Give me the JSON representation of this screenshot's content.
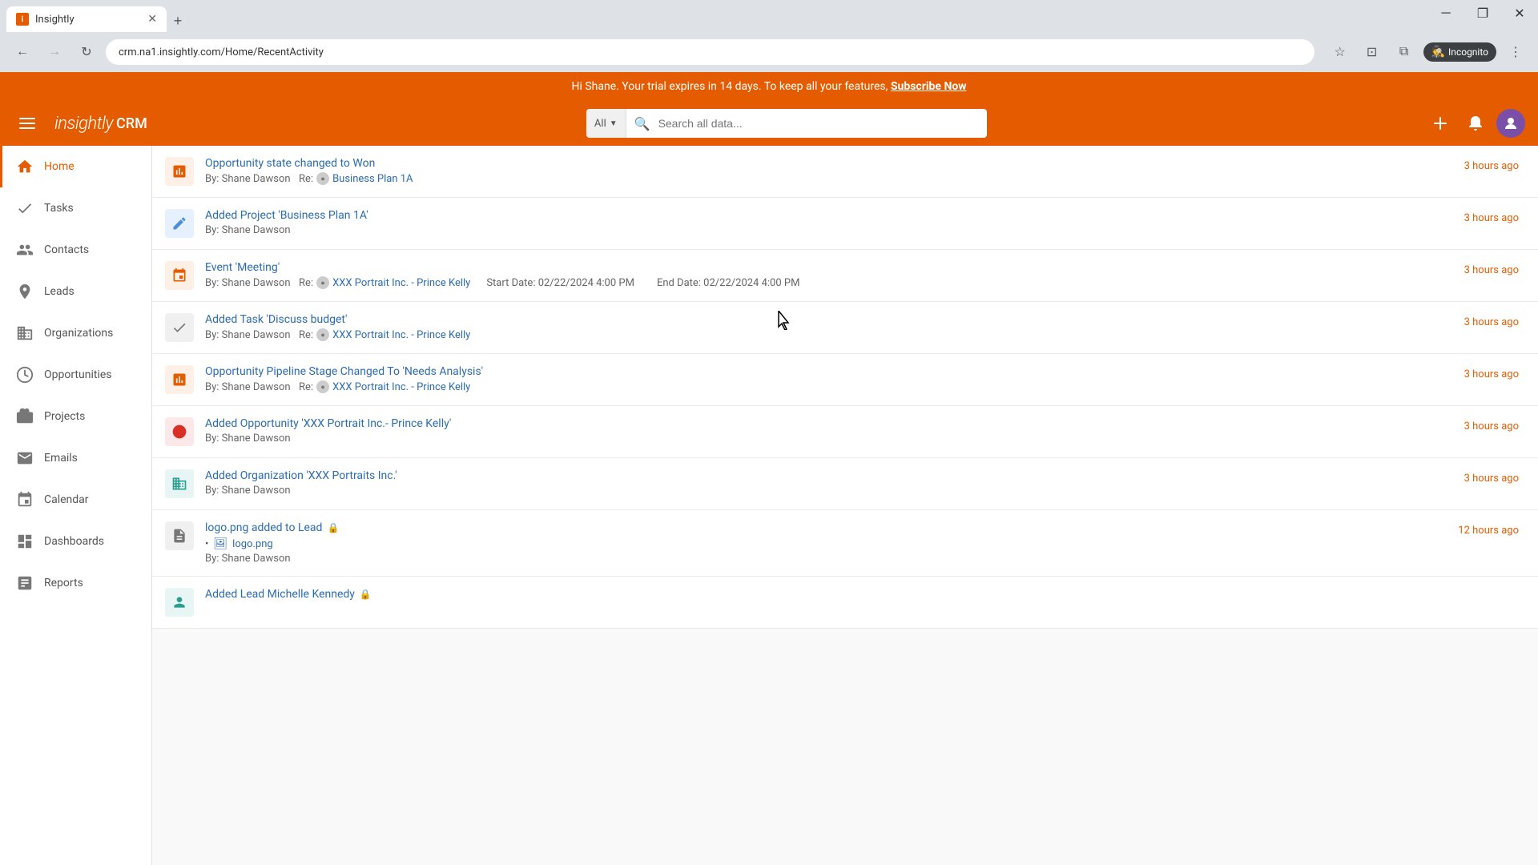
{
  "browser": {
    "tab_label": "Insightly",
    "url": "crm.na1.insightly.com/Home/RecentActivity",
    "nav_back_disabled": false,
    "nav_forward_disabled": true,
    "incognito_label": "Incognito"
  },
  "banner": {
    "text": "Hi Shane. Your trial expires in 14 days. To keep all your features,",
    "cta": "Subscribe Now"
  },
  "header": {
    "logo": "insightly",
    "crm": "CRM",
    "search_placeholder": "Search all data...",
    "search_all_label": "All"
  },
  "sidebar": {
    "items": [
      {
        "id": "home",
        "label": "Home",
        "active": true
      },
      {
        "id": "tasks",
        "label": "Tasks",
        "active": false
      },
      {
        "id": "contacts",
        "label": "Contacts",
        "active": false
      },
      {
        "id": "leads",
        "label": "Leads",
        "active": false
      },
      {
        "id": "organizations",
        "label": "Organizations",
        "active": false
      },
      {
        "id": "opportunities",
        "label": "Opportunities",
        "active": false
      },
      {
        "id": "projects",
        "label": "Projects",
        "active": false
      },
      {
        "id": "emails",
        "label": "Emails",
        "active": false
      },
      {
        "id": "calendar",
        "label": "Calendar",
        "active": false
      },
      {
        "id": "dashboards",
        "label": "Dashboards",
        "active": false
      },
      {
        "id": "reports",
        "label": "Reports",
        "active": false
      }
    ]
  },
  "activities": [
    {
      "id": 1,
      "icon_type": "orange",
      "icon_char": "📋",
      "title": "Opportunity state changed to Won",
      "by": "Shane Dawson",
      "re": "Business Plan 1A",
      "has_org_icon": true,
      "time": "3 hours ago",
      "detail": ""
    },
    {
      "id": 2,
      "icon_type": "blue",
      "icon_char": "✏️",
      "title": "Added Project 'Business Plan 1A'",
      "by": "Shane Dawson",
      "re": "",
      "has_org_icon": false,
      "time": "3 hours ago",
      "detail": ""
    },
    {
      "id": 3,
      "icon_type": "orange",
      "icon_char": "📅",
      "title": "Event 'Meeting'",
      "by": "Shane Dawson",
      "re": "XXX Portrait Inc. - Prince Kelly",
      "has_org_icon": true,
      "time": "3 hours ago",
      "detail": "Start Date: 02/22/2024 4:00 PM     End Date: 02/22/2024 4:00 PM"
    },
    {
      "id": 4,
      "icon_type": "gray",
      "icon_char": "✅",
      "title": "Added Task 'Discuss budget'",
      "by": "Shane Dawson",
      "re": "XXX Portrait Inc. - Prince Kelly",
      "has_org_icon": true,
      "time": "3 hours ago",
      "detail": ""
    },
    {
      "id": 5,
      "icon_type": "orange",
      "icon_char": "📋",
      "title": "Opportunity Pipeline Stage Changed To 'Needs Analysis'",
      "by": "Shane Dawson",
      "re": "XXX Portrait Inc. - Prince Kelly",
      "has_org_icon": true,
      "time": "3 hours ago",
      "detail": ""
    },
    {
      "id": 6,
      "icon_type": "red",
      "icon_char": "🔴",
      "title": "Added Opportunity 'XXX Portrait Inc.- Prince Kelly'",
      "by": "Shane Dawson",
      "re": "",
      "has_org_icon": false,
      "time": "3 hours ago",
      "detail": ""
    },
    {
      "id": 7,
      "icon_type": "teal",
      "icon_char": "🏢",
      "title": "Added Organization 'XXX Portraits Inc.'",
      "by": "Shane Dawson",
      "re": "",
      "has_org_icon": false,
      "time": "3 hours ago",
      "detail": ""
    },
    {
      "id": 8,
      "icon_type": "gray",
      "icon_char": "📄",
      "title": "logo.png added to Lead",
      "has_lock": true,
      "by": "Shane Dawson",
      "re": "",
      "has_org_icon": false,
      "time": "12 hours ago",
      "has_file": true,
      "file_name": "logo.png",
      "detail": ""
    },
    {
      "id": 9,
      "icon_type": "teal",
      "icon_char": "👤",
      "title": "Added Lead Michelle Kennedy",
      "has_lock": true,
      "by": "",
      "re": "",
      "has_org_icon": false,
      "time": "",
      "detail": ""
    }
  ]
}
